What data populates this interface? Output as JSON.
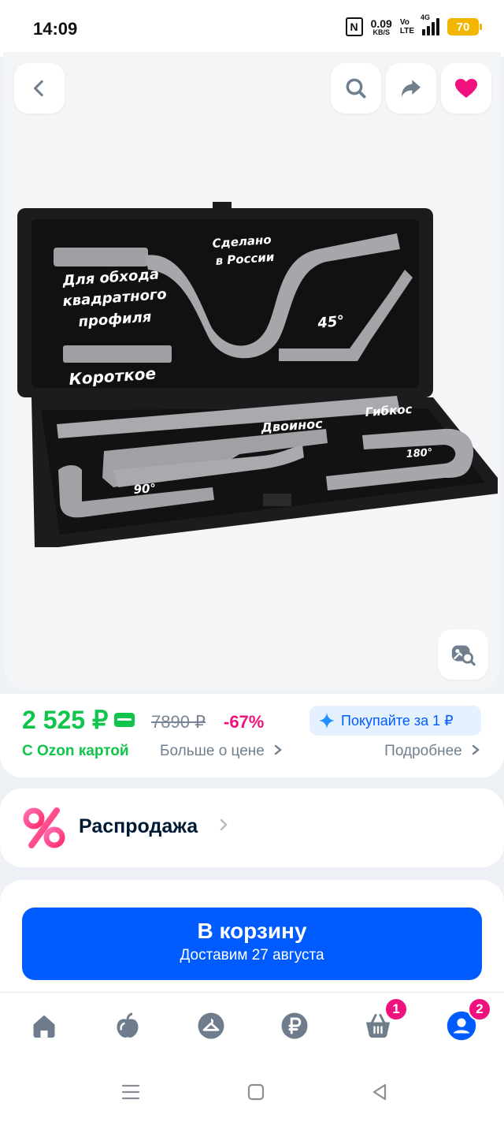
{
  "status_bar": {
    "time": "14:09",
    "net_speed": "0.09",
    "net_unit": "KB/S",
    "volte_top": "Vo",
    "volte_bottom": "LTE",
    "network": "4G",
    "battery": "70"
  },
  "gallery": {
    "back_icon": "chevron-left-icon",
    "search_icon": "search-icon",
    "share_icon": "share-arrow-icon",
    "favorite_icon": "heart-icon",
    "visual_search_icon": "image-search-icon",
    "photo_labels": {
      "made_in": "Сделано в России",
      "square_profile": "Для обхода квадратного профиля",
      "short": "Короткое",
      "angle_45": "45°",
      "double_nose": "Двоинос",
      "flexible": "Гибкос",
      "angle_180": "180°",
      "angle_90": "90°"
    }
  },
  "price": {
    "current": "2 525 ₽",
    "old": "7890 ₽",
    "discount": "-67%",
    "ozon_card": "С Ozon картой",
    "more_about_price": "Больше о цене",
    "promo": "Покупайте за 1 ₽",
    "details": "Подробнее"
  },
  "sale": {
    "label": "Распродажа"
  },
  "cart_button": {
    "label": "В корзину",
    "delivery": "Доставим 27 августа"
  },
  "bottom_nav": {
    "cart_badge": "1",
    "profile_badge": "2"
  },
  "colors": {
    "accent": "#005bff",
    "price_green": "#10c44c",
    "discount_pink": "#f1117e"
  }
}
